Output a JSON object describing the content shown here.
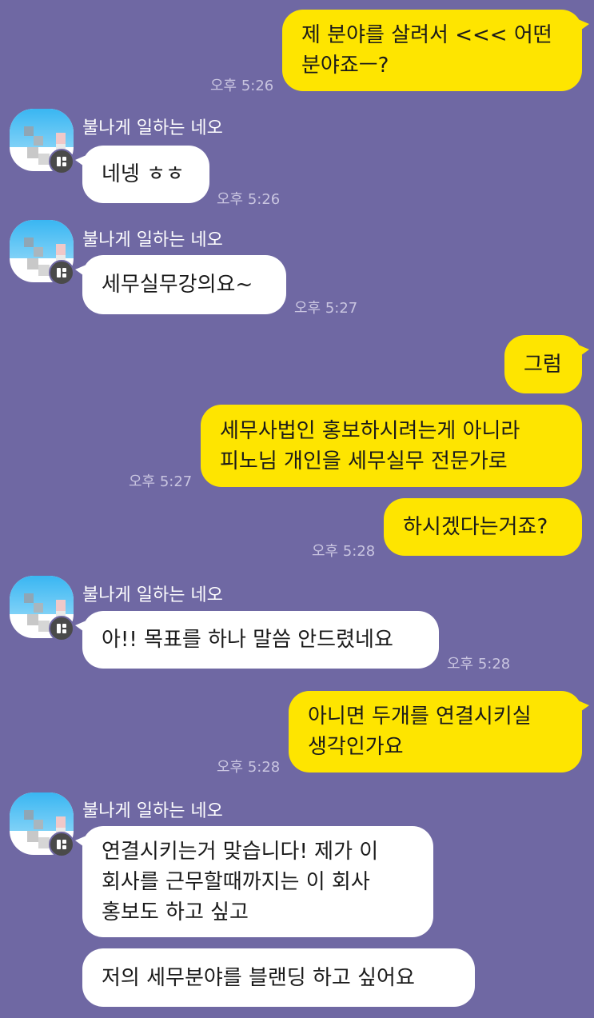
{
  "messages": [
    {
      "text": "제 분야를 살려서 <<< 어떤\n분야죠ㅡ?",
      "time": "오후 5:26"
    },
    {
      "sender": "불나게 일하는 네오",
      "text": "네넹 ㅎㅎ",
      "time": "오후 5:26"
    },
    {
      "sender": "불나게 일하는 네오",
      "text": "세무실무강의요~",
      "time": "오후 5:27"
    },
    {
      "text": "그럼"
    },
    {
      "text": "세무사법인 홍보하시려는게 아니라\n피노님 개인을 세무실무 전문가로",
      "time": "오후 5:27"
    },
    {
      "text": "하시겠다는거죠?",
      "time": "오후 5:28"
    },
    {
      "sender": "불나게 일하는 네오",
      "text": "아!! 목표를 하나 말씀 안드렸네요",
      "time": "오후 5:28"
    },
    {
      "text": "아니면 두개를 연결시키실\n생각인가요",
      "time": "오후 5:28"
    },
    {
      "sender": "불나게 일하는 네오",
      "text": "연결시키는거 맞습니다! 제가 이\n회사를 근무할때까지는 이 회사\n홍보도 하고 싶고"
    },
    {
      "text": "저의 세무분야를 블랜딩 하고 싶어요"
    }
  ]
}
